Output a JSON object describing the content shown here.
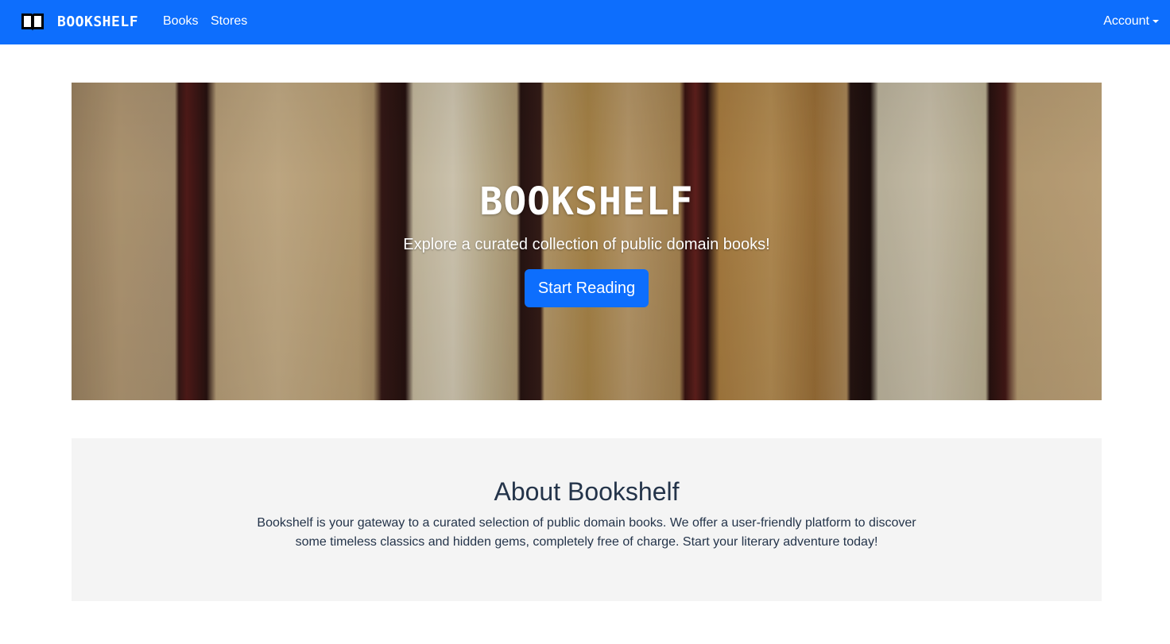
{
  "navbar": {
    "brand_icon": "book-open-icon",
    "brand_text": "BOOKSHELF",
    "links": [
      {
        "label": "Books"
      },
      {
        "label": "Stores"
      }
    ],
    "account_label": "Account",
    "background_color": "#0d6efd"
  },
  "hero": {
    "title": "BOOKSHELF",
    "subtitle": "Explore a curated collection of public domain books!",
    "button_label": "Start Reading",
    "background_image": "book-spines-photo"
  },
  "about": {
    "title": "About Bookshelf",
    "text": "Bookshelf is your gateway to a curated selection of public domain books. We offer a user-friendly platform to discover some timeless classics and hidden gems, completely free of charge. Start your literary adventure today!"
  }
}
